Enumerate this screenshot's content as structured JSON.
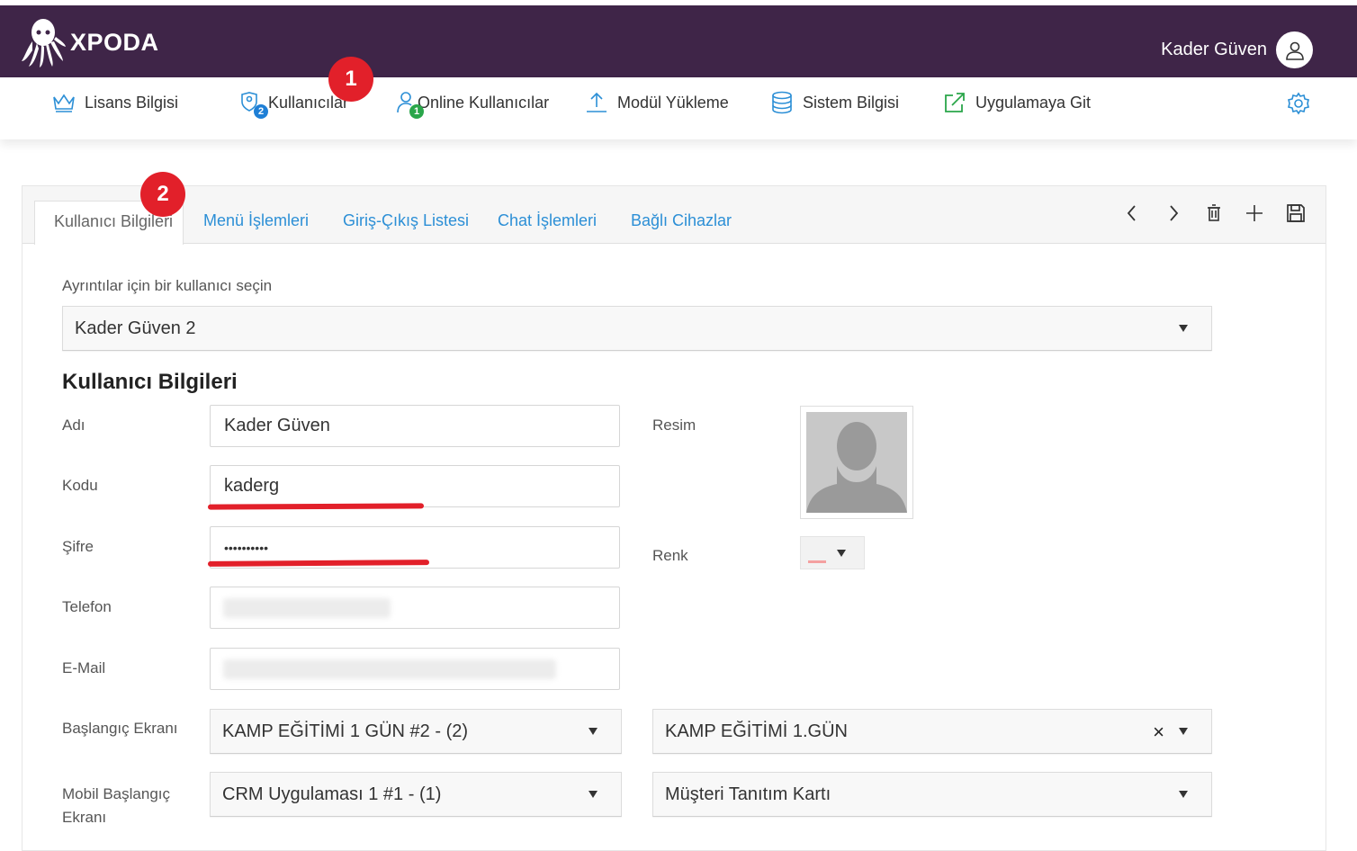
{
  "app": {
    "brand": "XPODA",
    "user_name": "Kader Güven"
  },
  "nav": {
    "items": [
      {
        "label": "Lisans Bilgisi",
        "icon": "crown-icon"
      },
      {
        "label": "Kullanıcılar",
        "icon": "users-shield-icon",
        "badge": "2"
      },
      {
        "label": "Online Kullanıcılar",
        "icon": "user-online-icon",
        "badge": "1"
      },
      {
        "label": "Modül Yükleme",
        "icon": "upload-icon"
      },
      {
        "label": "Sistem Bilgisi",
        "icon": "database-icon"
      },
      {
        "label": "Uygulamaya Git",
        "icon": "external-link-icon"
      }
    ],
    "settings_icon": "gear-icon"
  },
  "callouts": {
    "one": "1",
    "two": "2"
  },
  "tabs": [
    {
      "label": "Kullanıcı Bilgileri",
      "active": true
    },
    {
      "label": "Menü İşlemleri"
    },
    {
      "label": "Giriş-Çıkış Listesi"
    },
    {
      "label": "Chat İşlemleri"
    },
    {
      "label": "Bağlı Cihazlar"
    }
  ],
  "toolbar": {
    "icons": [
      "chevron-left-icon",
      "chevron-right-icon",
      "trash-icon",
      "plus-icon",
      "save-icon"
    ]
  },
  "user_select": {
    "label": "Ayrıntılar için bir kullanıcı seçin",
    "value": "Kader Güven 2"
  },
  "section_title": "Kullanıcı Bilgileri",
  "form": {
    "adi": {
      "label": "Adı",
      "value": "Kader Güven"
    },
    "kodu": {
      "label": "Kodu",
      "value": "kaderg"
    },
    "sifre": {
      "label": "Şifre",
      "value": "••••••••••"
    },
    "telefon": {
      "label": "Telefon"
    },
    "email": {
      "label": "E-Mail"
    },
    "resim": {
      "label": "Resim"
    },
    "renk": {
      "label": "Renk",
      "color": "#f4a0a0"
    },
    "baslangic": {
      "label": "Başlangıç Ekranı",
      "value1": "KAMP EĞİTİMİ 1 GÜN #2 - (2)",
      "value2": "KAMP EĞİTİMİ 1.GÜN"
    },
    "mobil": {
      "label_line1": "Mobil Başlangıç",
      "label_line2": "Ekranı",
      "value1": "CRM Uygulaması 1 #1 - (1)",
      "value2": "Müşteri Tanıtım Kartı"
    }
  },
  "colors": {
    "header_bg": "#3f2548",
    "link_blue": "#2c8fd6",
    "callout_red": "#e2202a",
    "badge_blue": "#1e7fd6",
    "badge_green": "#2aa64a"
  }
}
